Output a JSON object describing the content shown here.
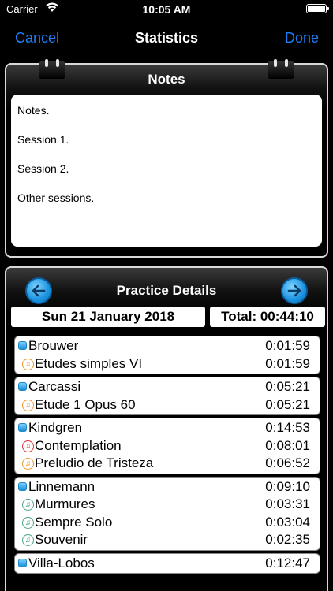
{
  "status": {
    "carrier": "Carrier",
    "time": "10:05 AM"
  },
  "nav": {
    "cancel": "Cancel",
    "title": "Statistics",
    "done": "Done",
    "accent": "#1e7cf2"
  },
  "notes": {
    "title": "Notes",
    "lines": [
      "Notes.",
      "Session 1.",
      "Session 2.",
      "Other sessions."
    ]
  },
  "practice": {
    "title": "Practice Details",
    "date": "Sun 21 January 2018",
    "total": "Total: 00:44:10",
    "groups": [
      {
        "composer": "Brouwer",
        "time": "0:01:59",
        "pieces": [
          {
            "name": "Etudes simples VI",
            "time": "0:01:59",
            "color": "orange"
          }
        ]
      },
      {
        "composer": "Carcassi",
        "time": "0:05:21",
        "pieces": [
          {
            "name": "Etude 1 Opus 60",
            "time": "0:05:21",
            "color": "orange"
          }
        ]
      },
      {
        "composer": "Kindgren",
        "time": "0:14:53",
        "pieces": [
          {
            "name": "Contemplation",
            "time": "0:08:01",
            "color": "red"
          },
          {
            "name": "Preludio de Tristeza",
            "time": "0:06:52",
            "color": "orange"
          }
        ]
      },
      {
        "composer": "Linnemann",
        "time": "0:09:10",
        "pieces": [
          {
            "name": "Murmures",
            "time": "0:03:31",
            "color": "green"
          },
          {
            "name": "Sempre Solo",
            "time": "0:03:04",
            "color": "green"
          },
          {
            "name": "Souvenir",
            "time": "0:02:35",
            "color": "green"
          }
        ]
      },
      {
        "composer": "Villa-Lobos",
        "time": "0:12:47",
        "pieces": []
      }
    ]
  }
}
